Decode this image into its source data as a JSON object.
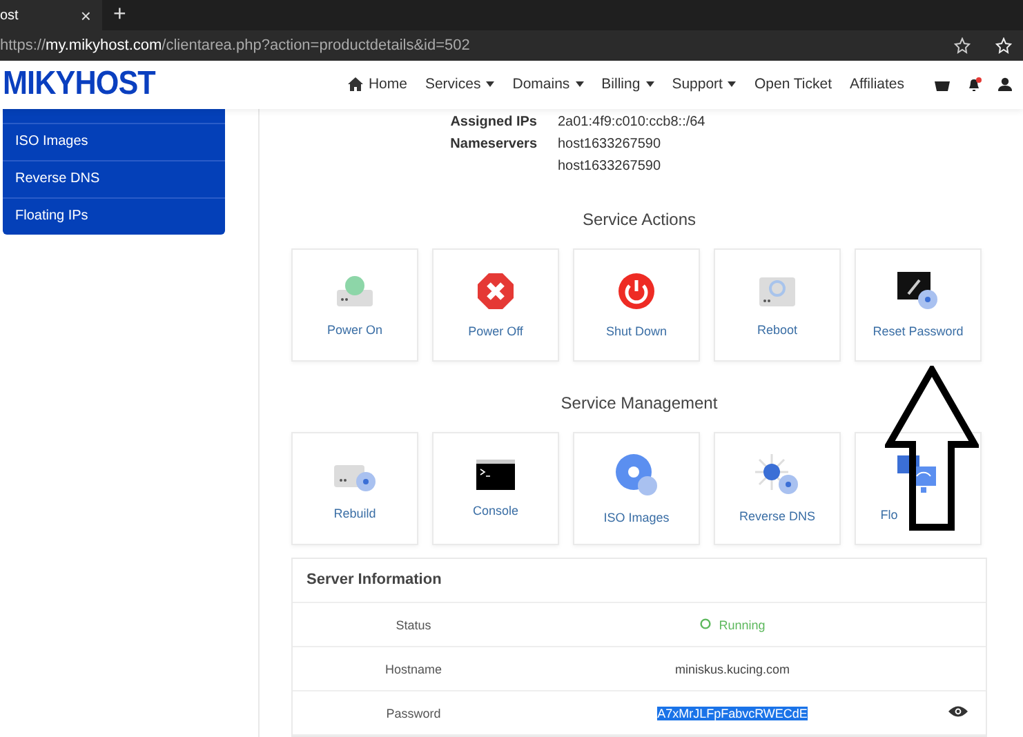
{
  "browser": {
    "tab_title": "ost",
    "tab_close": "×",
    "new_tab": "+",
    "url_prefix": "https://",
    "url_host": "my.mikyhost.com",
    "url_path": "/clientarea.php?action=productdetails&id=502"
  },
  "header": {
    "logo": "MIKYHOST",
    "nav": [
      {
        "label": "Home",
        "kind": "home"
      },
      {
        "label": "Services",
        "kind": "dropdown"
      },
      {
        "label": "Domains",
        "kind": "dropdown"
      },
      {
        "label": "Billing",
        "kind": "dropdown"
      },
      {
        "label": "Support",
        "kind": "dropdown"
      },
      {
        "label": "Open Ticket",
        "kind": "plain"
      },
      {
        "label": "Affiliates",
        "kind": "plain"
      }
    ],
    "has_notification": true
  },
  "sidebar": {
    "items": [
      "ISO Images",
      "Reverse DNS",
      "Floating IPs"
    ]
  },
  "details": [
    {
      "label": "Assigned IPs",
      "values": [
        "2a01:4f9:c010:ccb8::/64"
      ]
    },
    {
      "label": "Nameservers",
      "values": [
        "host1633267590",
        "host1633267590"
      ]
    }
  ],
  "service_actions": {
    "title": "Service Actions",
    "items": [
      "Power On",
      "Power Off",
      "Shut Down",
      "Reboot",
      "Reset Password"
    ]
  },
  "service_management": {
    "title": "Service Management",
    "items": [
      "Rebuild",
      "Console",
      "ISO Images",
      "Reverse DNS",
      "Flo"
    ]
  },
  "server_information": {
    "title": "Server Information",
    "rows": [
      {
        "label": "Status",
        "value": "Running",
        "kind": "status"
      },
      {
        "label": "Hostname",
        "value": "miniskus.kucing.com",
        "kind": "text"
      },
      {
        "label": "Password",
        "value": "A7xMrJLFpFabvcRWECdE",
        "kind": "secret",
        "selected": true
      }
    ]
  },
  "annotation": {
    "kind": "up-arrow"
  }
}
